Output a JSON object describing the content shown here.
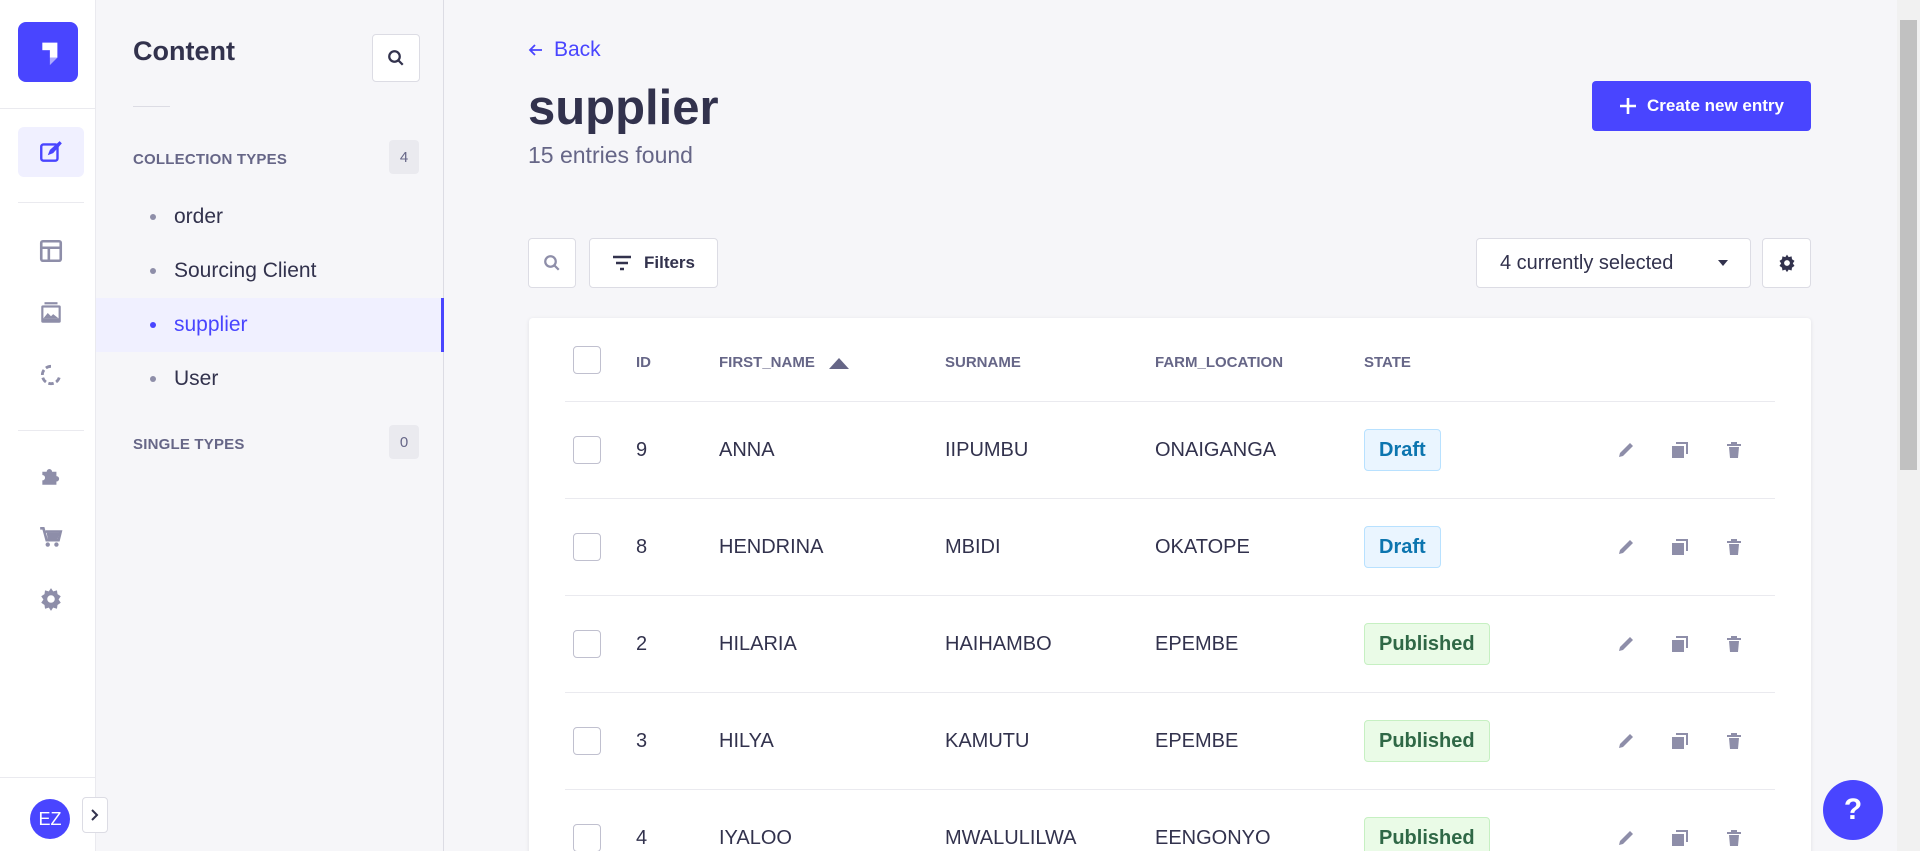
{
  "app": {
    "avatar_initials": "EZ",
    "help_label": "?"
  },
  "rail": {
    "icons": [
      "content-manager-icon",
      "content-type-builder-icon",
      "media-library-icon",
      "releases-icon",
      "plugins-icon",
      "marketplace-icon",
      "settings-icon"
    ]
  },
  "subnav": {
    "title": "Content",
    "collection_types": {
      "label": "COLLECTION TYPES",
      "count": "4",
      "items": [
        {
          "label": "order"
        },
        {
          "label": "Sourcing Client"
        },
        {
          "label": "supplier"
        },
        {
          "label": "User"
        }
      ]
    },
    "single_types": {
      "label": "SINGLE TYPES",
      "count": "0"
    }
  },
  "header": {
    "back_label": "Back",
    "title": "supplier",
    "subtitle": "15 entries found",
    "create_label": "Create new entry"
  },
  "toolbar": {
    "filters_label": "Filters",
    "columns_select": "4 currently selected"
  },
  "table": {
    "columns": [
      "ID",
      "FIRST_NAME",
      "SURNAME",
      "FARM_LOCATION",
      "STATE"
    ],
    "sorted_column": "FIRST_NAME",
    "rows": [
      {
        "id": "9",
        "first_name": "ANNA",
        "surname": "IIPUMBU",
        "farm_location": "ONAIGANGA",
        "state": "Draft"
      },
      {
        "id": "8",
        "first_name": "HENDRINA",
        "surname": "MBIDI",
        "farm_location": "OKATOPE",
        "state": "Draft"
      },
      {
        "id": "2",
        "first_name": "HILARIA",
        "surname": "HAIHAMBO",
        "farm_location": "EPEMBE",
        "state": "Published"
      },
      {
        "id": "3",
        "first_name": "HILYA",
        "surname": "KAMUTU",
        "farm_location": "EPEMBE",
        "state": "Published"
      },
      {
        "id": "4",
        "first_name": "IYALOO",
        "surname": "MWALULILWA",
        "farm_location": "EENGONYO",
        "state": "Published"
      }
    ]
  },
  "colors": {
    "primary": "#4945ff",
    "draft_text": "#0c75af",
    "published_text": "#2f6846"
  }
}
